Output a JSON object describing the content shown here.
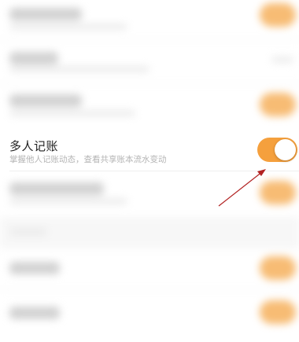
{
  "setting": {
    "title": "多人记账",
    "subtitle": "掌握他人记账动态，查看共享账本流水变动",
    "enabled": true
  },
  "colors": {
    "accent": "#f5a03d",
    "arrow": "#b22222"
  }
}
